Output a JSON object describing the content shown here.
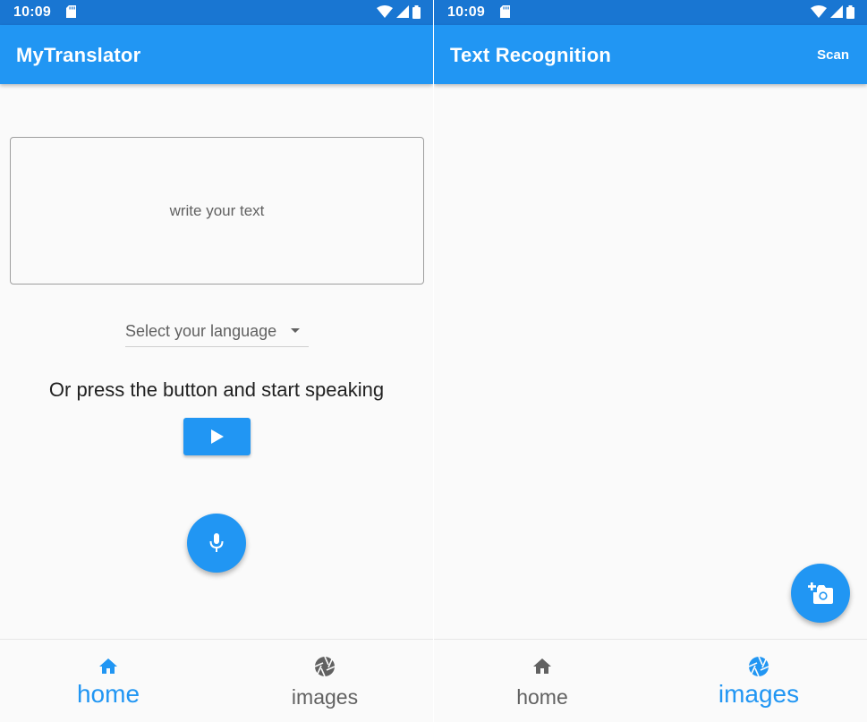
{
  "colors": {
    "primary": "#2196f3",
    "primary_dark": "#1976d2",
    "inactive": "#616161"
  },
  "left_screen": {
    "status_bar": {
      "time": "10:09"
    },
    "app_bar": {
      "title": "MyTranslator"
    },
    "text_input": {
      "placeholder": "write your text",
      "value": ""
    },
    "language_dropdown": {
      "label": "Select your language"
    },
    "speak_prompt": "Or press the button and start speaking",
    "play_button": {
      "icon": "play-icon"
    },
    "fab": {
      "icon": "mic-icon"
    },
    "bottom_nav": {
      "items": [
        {
          "label": "home",
          "icon": "home-icon",
          "active": true
        },
        {
          "label": "images",
          "icon": "camera-shutter-icon",
          "active": false
        }
      ]
    }
  },
  "right_screen": {
    "status_bar": {
      "time": "10:09"
    },
    "app_bar": {
      "title": "Text Recognition",
      "action": "Scan"
    },
    "fab": {
      "icon": "add-a-photo-icon"
    },
    "bottom_nav": {
      "items": [
        {
          "label": "home",
          "icon": "home-icon",
          "active": false
        },
        {
          "label": "images",
          "icon": "camera-shutter-icon",
          "active": true
        }
      ]
    }
  }
}
